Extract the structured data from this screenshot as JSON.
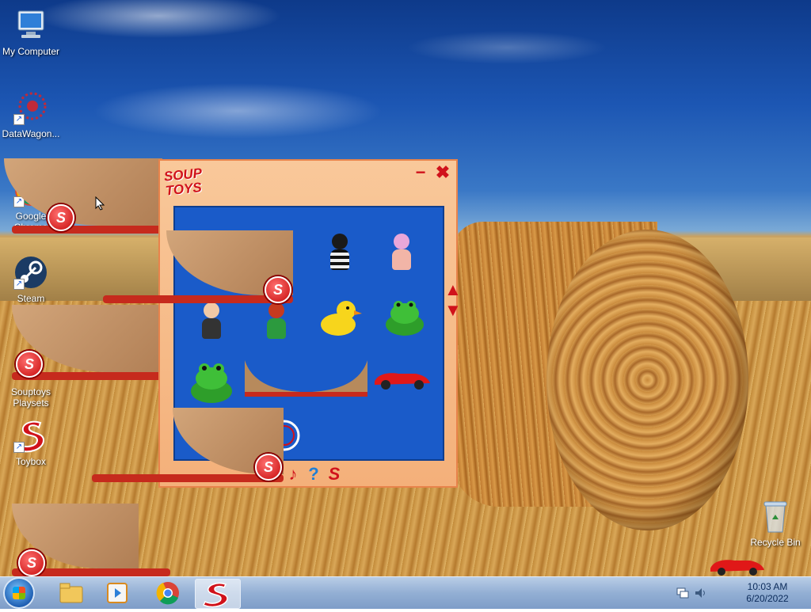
{
  "desktop": {
    "icons": [
      {
        "label": "My Computer",
        "icon": "computer-icon"
      },
      {
        "label": "DataWagon...",
        "icon": "datawagon-icon"
      },
      {
        "label": "Google Chrome",
        "icon": "chrome-icon"
      },
      {
        "label": "Steam",
        "icon": "steam-icon"
      },
      {
        "label": "Souptoys Playsets",
        "icon": "souptoys-icon"
      },
      {
        "label": "Toybox",
        "icon": "toybox-icon"
      },
      {
        "label": "Recycle Bin",
        "icon": "recycle-bin-icon"
      }
    ]
  },
  "app": {
    "logo_top": "SOUP",
    "logo_bottom": "TOYS",
    "minimize_label": "−",
    "close_label": "✖",
    "toolbar": [
      "?",
      "S"
    ]
  },
  "taskbar": {
    "time": "10:03 AM",
    "date": "6/20/2022"
  },
  "colors": {
    "accent_red": "#d0121b",
    "playfield_blue": "#1a5bc9",
    "window_orange": "#f4b07a"
  }
}
